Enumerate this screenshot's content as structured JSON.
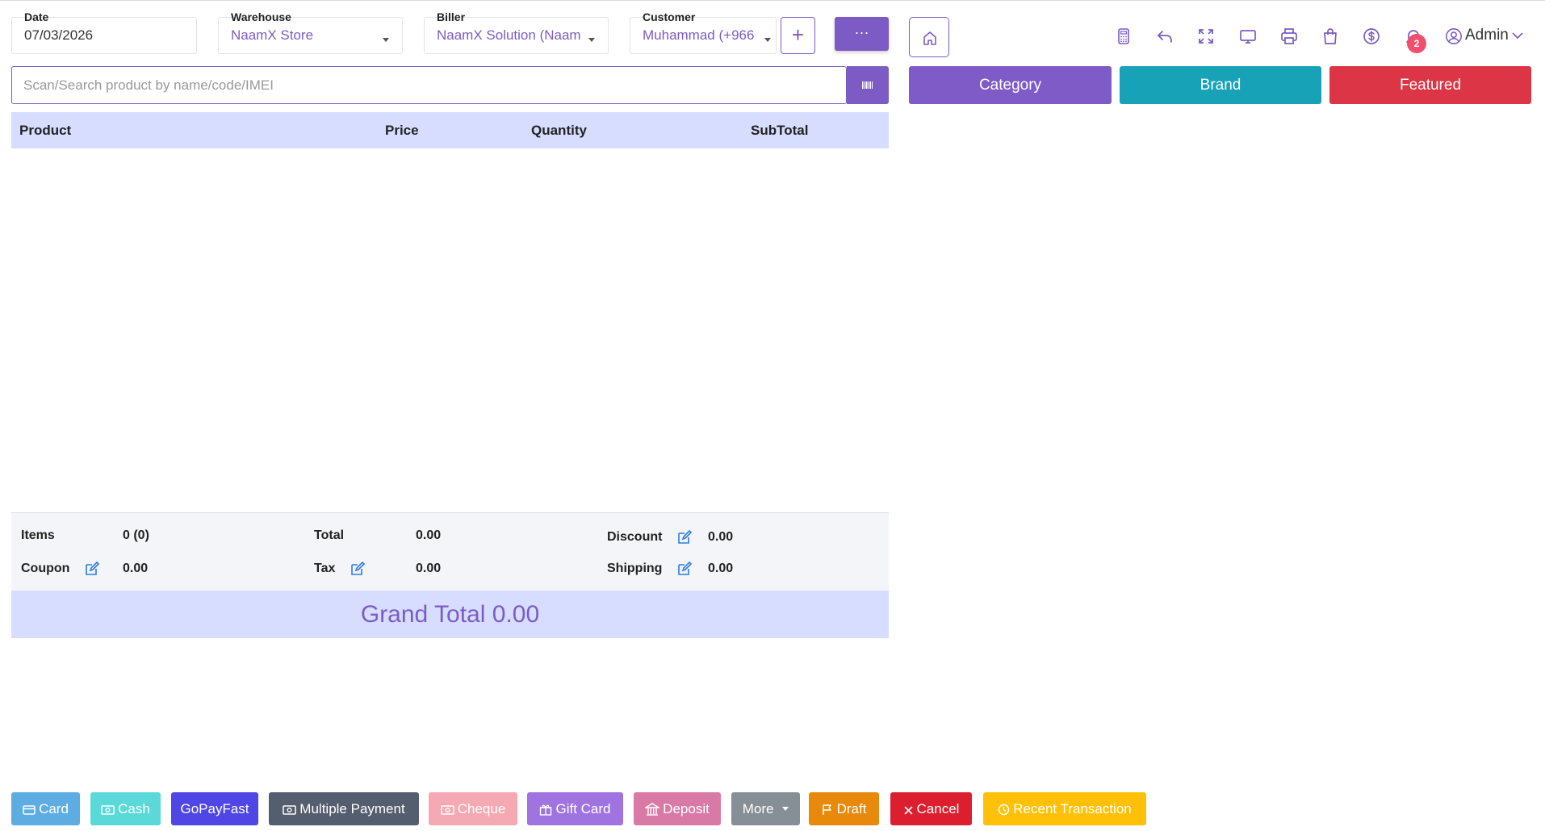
{
  "filters": {
    "date": {
      "label": "Date",
      "value": "07/03/2026"
    },
    "warehouse": {
      "label": "Warehouse",
      "value": "NaamX Store"
    },
    "biller": {
      "label": "Biller",
      "value": "NaamX Solution (Naam"
    },
    "customer": {
      "label": "Customer",
      "value": "Muhammad (+966"
    },
    "add_symbol": "+",
    "more_symbol": "···"
  },
  "search": {
    "placeholder": "Scan/Search product by name/code/IMEI"
  },
  "table": {
    "columns": [
      "Product",
      "Price",
      "Quantity",
      "SubTotal"
    ]
  },
  "summary": {
    "items_label": "Items",
    "items_value": "0 (0)",
    "total_label": "Total",
    "total_value": "0.00",
    "discount_label": "Discount",
    "discount_value": "0.00",
    "coupon_label": "Coupon",
    "coupon_value": "0.00",
    "tax_label": "Tax",
    "tax_value": "0.00",
    "shipping_label": "Shipping",
    "shipping_value": "0.00",
    "grand_total": "Grand Total 0.00"
  },
  "header": {
    "admin_label": "Admin",
    "notification_count": "2",
    "icons": [
      "calculator-icon",
      "undo-icon",
      "fullscreen-icon",
      "monitor-icon",
      "printer-icon",
      "shopping-bag-icon",
      "dollar-icon",
      "bell-icon",
      "user-icon"
    ]
  },
  "catalog_buttons": {
    "category": "Category",
    "brand": "Brand",
    "featured": "Featured"
  },
  "payment_buttons": {
    "card": "Card",
    "cash": "Cash",
    "gopayfast": "GoPayFast",
    "multiple": "Multiple Payment",
    "cheque": "Cheque",
    "gift_card": "Gift Card",
    "deposit": "Deposit",
    "more": "More",
    "draft": "Draft",
    "cancel": "Cancel",
    "recent": "Recent Transaction"
  },
  "colors": {
    "accent": "#7c5cc4",
    "category": "#7e5bc6",
    "brand": "#17a2b8",
    "featured": "#dc3545",
    "card": "#5dade2",
    "cash": "#5bd8d8",
    "gopayfast": "#5046e5",
    "multiple": "#555e6e",
    "cheque": "#f5a9b2",
    "gift_card": "#9f73e0",
    "deposit": "#d97aa6",
    "more": "#868e96",
    "draft": "#e8890c",
    "cancel": "#dc1f2e",
    "recent": "#ffc107"
  }
}
